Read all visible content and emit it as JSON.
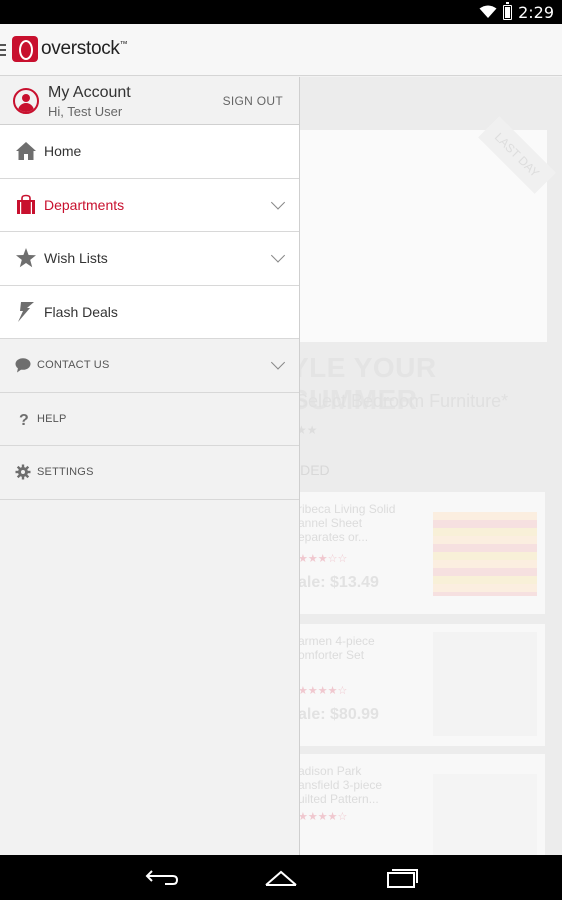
{
  "status_bar": {
    "time": "2:29"
  },
  "app": {
    "logo_text": "overstock",
    "logo_tm": "™"
  },
  "drawer": {
    "account": {
      "title": "My Account",
      "greeting": "Hi, Test User",
      "sign_out": "SIGN OUT",
      "icon": "user-icon"
    },
    "items": [
      {
        "label": "Home",
        "icon": "home-icon",
        "active": false,
        "expandable": false
      },
      {
        "label": "Departments",
        "icon": "shopping-bag-icon",
        "active": true,
        "expandable": true
      },
      {
        "label": "Wish Lists",
        "icon": "star-icon",
        "active": false,
        "expandable": true
      },
      {
        "label": "Flash Deals",
        "icon": "lightning-icon",
        "active": false,
        "expandable": false
      }
    ],
    "secondary_items": [
      {
        "label": "CONTACT US",
        "icon": "chat-bubble-icon",
        "expandable": true
      },
      {
        "label": "HELP",
        "icon": "question-mark-icon",
        "expandable": false
      },
      {
        "label": "SETTINGS",
        "icon": "gear-icon",
        "expandable": false
      }
    ]
  },
  "background_page": {
    "hero_ribbon": "LAST DAY",
    "headline": "YLE YOUR SUMMER",
    "subheadline": "Select Bedroom Furniture*",
    "section_label": "NDED",
    "products": [
      {
        "title": "ribeca Living Solid\nannel Sheet\neparates or...",
        "price": "ale: $13.49"
      },
      {
        "title": "armen 4-piece\nomforter Set",
        "price": "ale: $80.99"
      },
      {
        "title": "adison Park\nansfield 3-piece\nuilted Pattern...",
        "price": ""
      }
    ]
  },
  "colors": {
    "brand_red": "#c8102e",
    "drawer_bg": "#f2f2f2"
  },
  "nav_bar": {
    "back": "back-icon",
    "home": "home-nav-icon",
    "recents": "recents-icon"
  }
}
